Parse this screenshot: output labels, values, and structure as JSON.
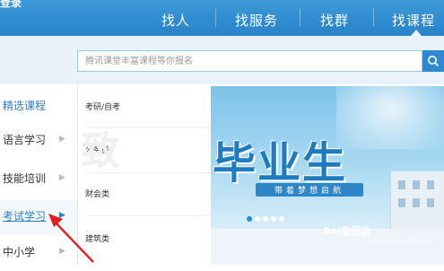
{
  "topbar": {
    "login_text": "登录",
    "nav": [
      "找人",
      "找服务",
      "找群",
      "找课程"
    ]
  },
  "search": {
    "placeholder": "腾讯课堂丰富课程等你报名"
  },
  "categories": [
    {
      "label": "精选课程"
    },
    {
      "label": "语言学习"
    },
    {
      "label": "技能培训"
    },
    {
      "label": "考试学习"
    },
    {
      "label": "中小学"
    }
  ],
  "subcategories": [
    "考研/自考",
    "公务员",
    "财会类",
    "建筑类"
  ],
  "watermark_char": "致",
  "banner": {
    "title": "毕业生",
    "ribbon": "带着梦想启航"
  },
  "carousel": {
    "count": 5,
    "active": 0
  },
  "baidu_watermark": {
    "brand": "Bai度经验",
    "url": "jingyan.baidu.com"
  },
  "colors": {
    "accent": "#2e8ad0",
    "active_link": "#2b7fc4",
    "pointer": "#e02020"
  }
}
